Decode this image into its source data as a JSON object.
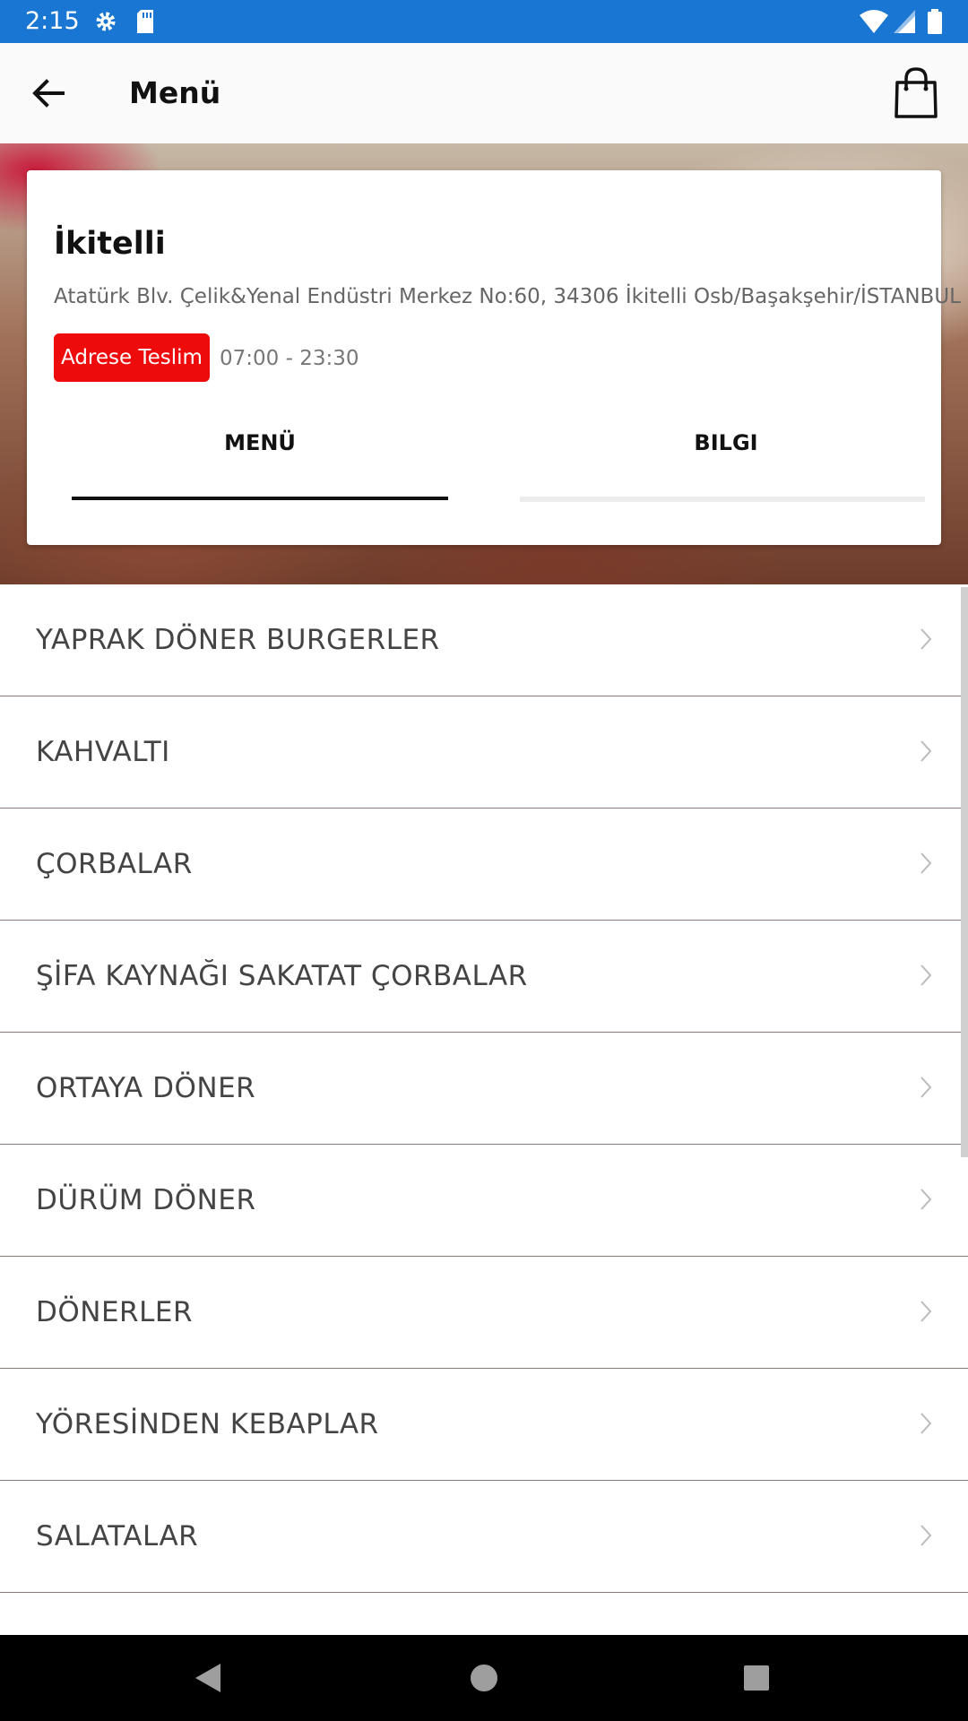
{
  "status_bar": {
    "time": "2:15"
  },
  "app_bar": {
    "title": "Menü"
  },
  "store": {
    "name": "İkitelli",
    "address": "Atatürk Blv. Çelik&Yenal Endüstri Merkez No:60, 34306 İkitelli Osb/Başakşehir/İSTANBUL",
    "badge": "Adrese Teslim",
    "hours": "07:00 - 23:30"
  },
  "tabs": {
    "menu": "MENÜ",
    "info": "BILGI"
  },
  "categories": [
    {
      "label": "YAPRAK DÖNER BURGERLER"
    },
    {
      "label": "KAHVALTI"
    },
    {
      "label": "ÇORBALAR"
    },
    {
      "label": "ŞİFA KAYNAĞI SAKATAT ÇORBALAR"
    },
    {
      "label": "ORTAYA DÖNER"
    },
    {
      "label": "DÜRÜM DÖNER"
    },
    {
      "label": "DÖNERLER"
    },
    {
      "label": "YÖRESİNDEN KEBAPLAR"
    },
    {
      "label": "SALATALAR"
    }
  ],
  "colors": {
    "status_bar": "#1976d2",
    "badge": "#ee0b0b"
  }
}
